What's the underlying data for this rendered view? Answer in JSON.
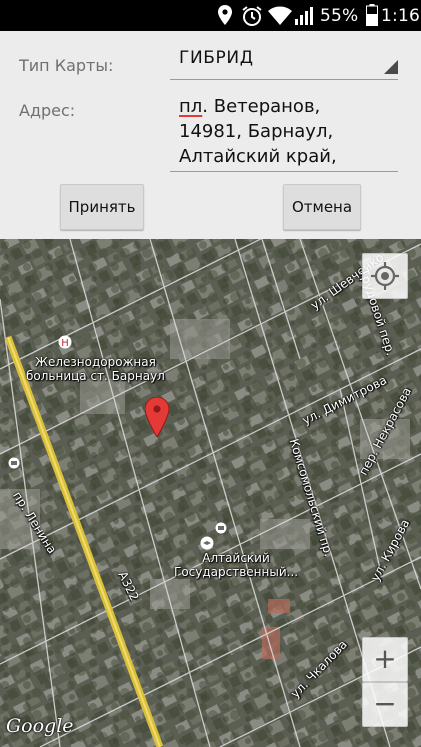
{
  "status": {
    "battery": "55%",
    "time": "1:16",
    "icons": [
      "location-icon",
      "alarm-icon",
      "wifi-icon",
      "signal-icon",
      "battery-icon"
    ]
  },
  "form": {
    "map_type_label": "Тип Карты:",
    "map_type_value": "ГИБРИД",
    "address_label": "Адрес:",
    "address_lines": {
      "l1_misspelled": "пл",
      "l1_rest": ". Ветеранов,",
      "l2": "14981, Барнаул,",
      "l3": "Алтайский край,"
    },
    "accept_button": "Принять",
    "cancel_button": "Отмена"
  },
  "map": {
    "labels": {
      "hospital": [
        "Железнодорожная",
        "больница ст. Барнаул"
      ],
      "university": [
        "Алтайский",
        "Государственный..."
      ],
      "lenina": "пр. Ленина",
      "a322": "А322",
      "dimitrova": "ул. Димитрова",
      "nekrasova": "пер. Некрасова",
      "komsomolsky": "Комсомольский пр.",
      "kirova": "ул. Кирова",
      "shevchenko": "ул. Шевченко",
      "trudovoy": "Трудовой пер.",
      "chkalova": "ул. Чкалова",
      "zoom_in": "+",
      "zoom_out": "−",
      "google": "Google"
    },
    "colors": {
      "highway": "#d9c03b",
      "pin": "#e53935",
      "spellcheck": "#e53935"
    }
  }
}
